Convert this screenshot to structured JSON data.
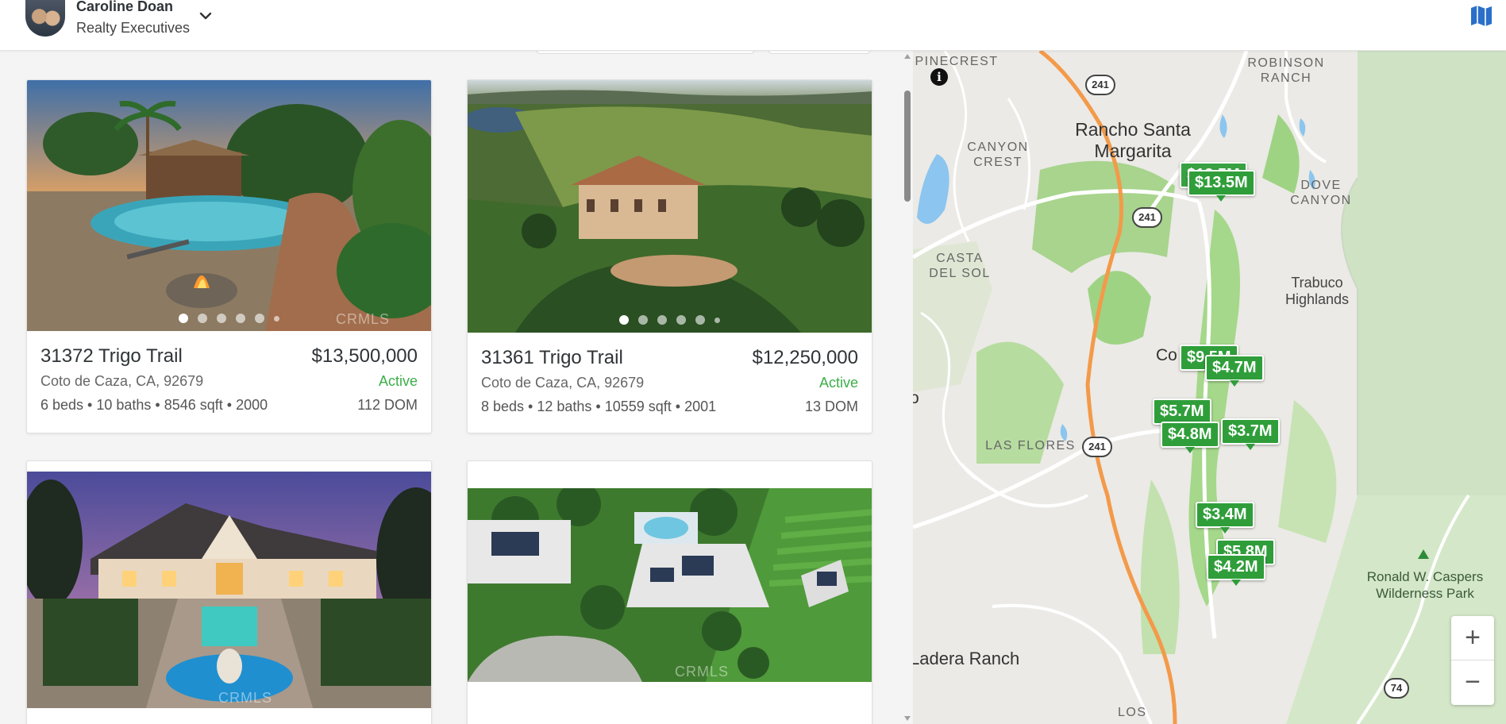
{
  "agent": {
    "name": "Caroline Doan",
    "company": "Realty Executives"
  },
  "listings": [
    {
      "address": "31372 Trigo Trail",
      "price": "$13,500,000",
      "city": "Coto de Caza, CA, 92679",
      "status": "Active",
      "specs": "6 beds • 10 baths • 8546 sqft • 2000",
      "dom": "112 DOM",
      "watermark": "CRMLS"
    },
    {
      "address": "31361 Trigo Trail",
      "price": "$12,250,000",
      "city": "Coto de Caza, CA, 92679",
      "status": "Active",
      "specs": "8 beds • 12 baths • 10559 sqft • 2001",
      "dom": "13 DOM",
      "watermark": ""
    },
    {
      "address": "",
      "price": "",
      "city": "",
      "status": "",
      "specs": "",
      "dom": "",
      "watermark": "CRMLS"
    },
    {
      "address": "",
      "price": "",
      "city": "",
      "status": "",
      "specs": "",
      "dom": "",
      "watermark": "CRMLS"
    }
  ],
  "map": {
    "places": {
      "pinecrest": "PINECREST",
      "robinson_ranch": "ROBINSON RANCH",
      "rancho_santa_margarita": "Rancho Santa Margarita",
      "canyon_crest": "CANYON CREST",
      "dove_canyon": "DOVE CANYON",
      "casta_del_sol": "CASTA DEL SOL",
      "trabuco_highlands": "Trabuco Highlands",
      "coto_de_caza": "Co",
      "las_flores": "LAS FLORES",
      "ladera_ranch": "Ladera Ranch",
      "los": "LOS",
      "caspers": "Ronald W. Caspers Wilderness Park",
      "edge_o": "o"
    },
    "shields": {
      "a": "241",
      "b": "241",
      "c": "241",
      "d": "74"
    },
    "pins": {
      "p1": "$13.5M",
      "p2": "$4.7M",
      "p3": "$9.5M",
      "p4": "$5.7M",
      "p5": "$4.8M",
      "p6": "$3.7M",
      "p7": "$3.4M",
      "p8": "$5.8M",
      "p9": "$4.2M"
    },
    "info_symbol": "i",
    "zoom_in": "+",
    "zoom_out": "−"
  }
}
